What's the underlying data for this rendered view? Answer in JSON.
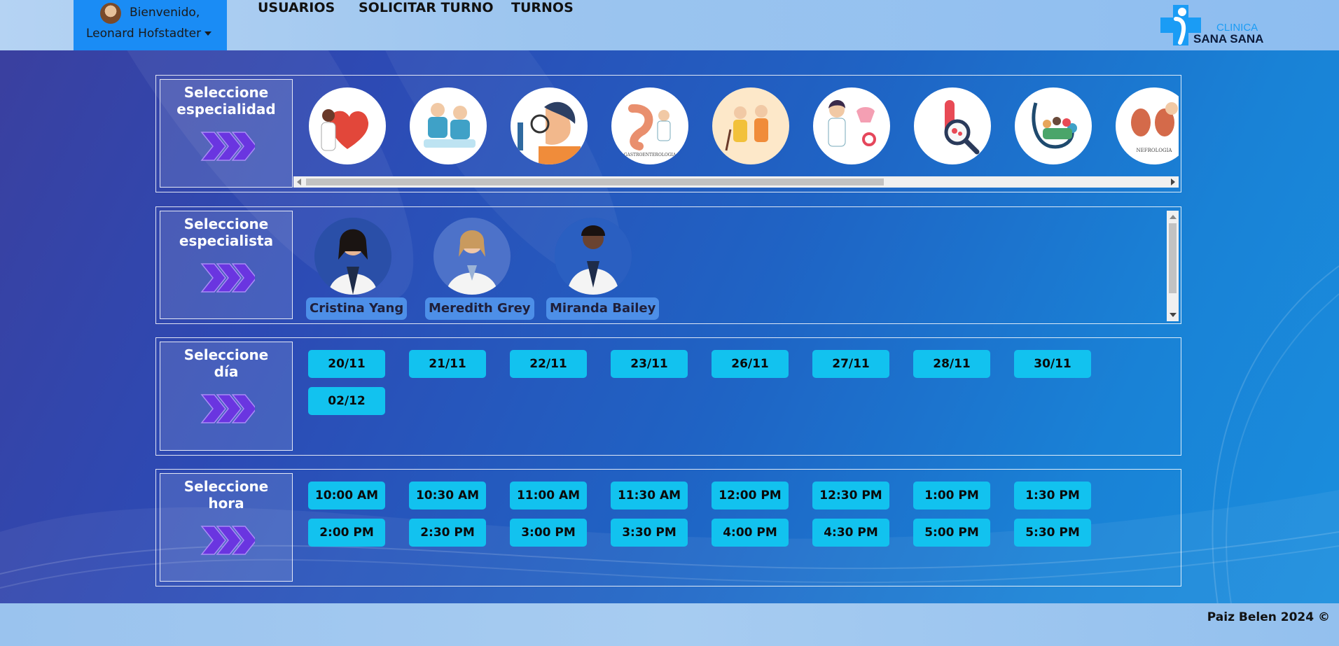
{
  "navbar": {
    "greeting": "Bienvenido,",
    "user_name": "Leonard Hofstadter",
    "links": [
      "USUARIOS",
      "SOLICITAR TURNO",
      "TURNOS"
    ],
    "logo": {
      "line1": "CLINICA",
      "line2": "SANA SANA"
    }
  },
  "especialidad": {
    "label": [
      "Seleccione",
      "especialidad"
    ],
    "items": [
      {
        "icon": "cardiology-icon"
      },
      {
        "icon": "surgery-icon"
      },
      {
        "icon": "dermatology-icon"
      },
      {
        "icon": "gastroenterology-icon",
        "caption": "GASTROENTEROLOGIA"
      },
      {
        "icon": "geriatrics-icon"
      },
      {
        "icon": "gynecology-icon"
      },
      {
        "icon": "lab-analysis-icon"
      },
      {
        "icon": "family-medicine-icon"
      },
      {
        "icon": "nephrology-icon",
        "caption": "NEFROLOGIA"
      }
    ]
  },
  "especialista": {
    "label": [
      "Seleccione",
      "especialista"
    ],
    "doctors": [
      "Cristina Yang",
      "Meredith Grey",
      "Miranda Bailey"
    ]
  },
  "dia": {
    "label": [
      "Seleccione",
      "día"
    ],
    "days": [
      "20/11",
      "21/11",
      "22/11",
      "23/11",
      "26/11",
      "27/11",
      "28/11",
      "30/11",
      "02/12"
    ]
  },
  "hora": {
    "label": [
      "Seleccione",
      "hora"
    ],
    "times": [
      "10:00 AM",
      "10:30 AM",
      "11:00 AM",
      "11:30 AM",
      "12:00 PM",
      "12:30 PM",
      "1:00 PM",
      "1:30 PM",
      "2:00 PM",
      "2:30 PM",
      "3:00 PM",
      "3:30 PM",
      "4:00 PM",
      "4:30 PM",
      "5:00 PM",
      "5:30 PM"
    ]
  },
  "footer": {
    "text": "Paiz Belen 2024 ©"
  },
  "colors": {
    "pill": "#12c2ef",
    "user_box": "#1a8cf5",
    "arrows": "#6a35e0"
  }
}
